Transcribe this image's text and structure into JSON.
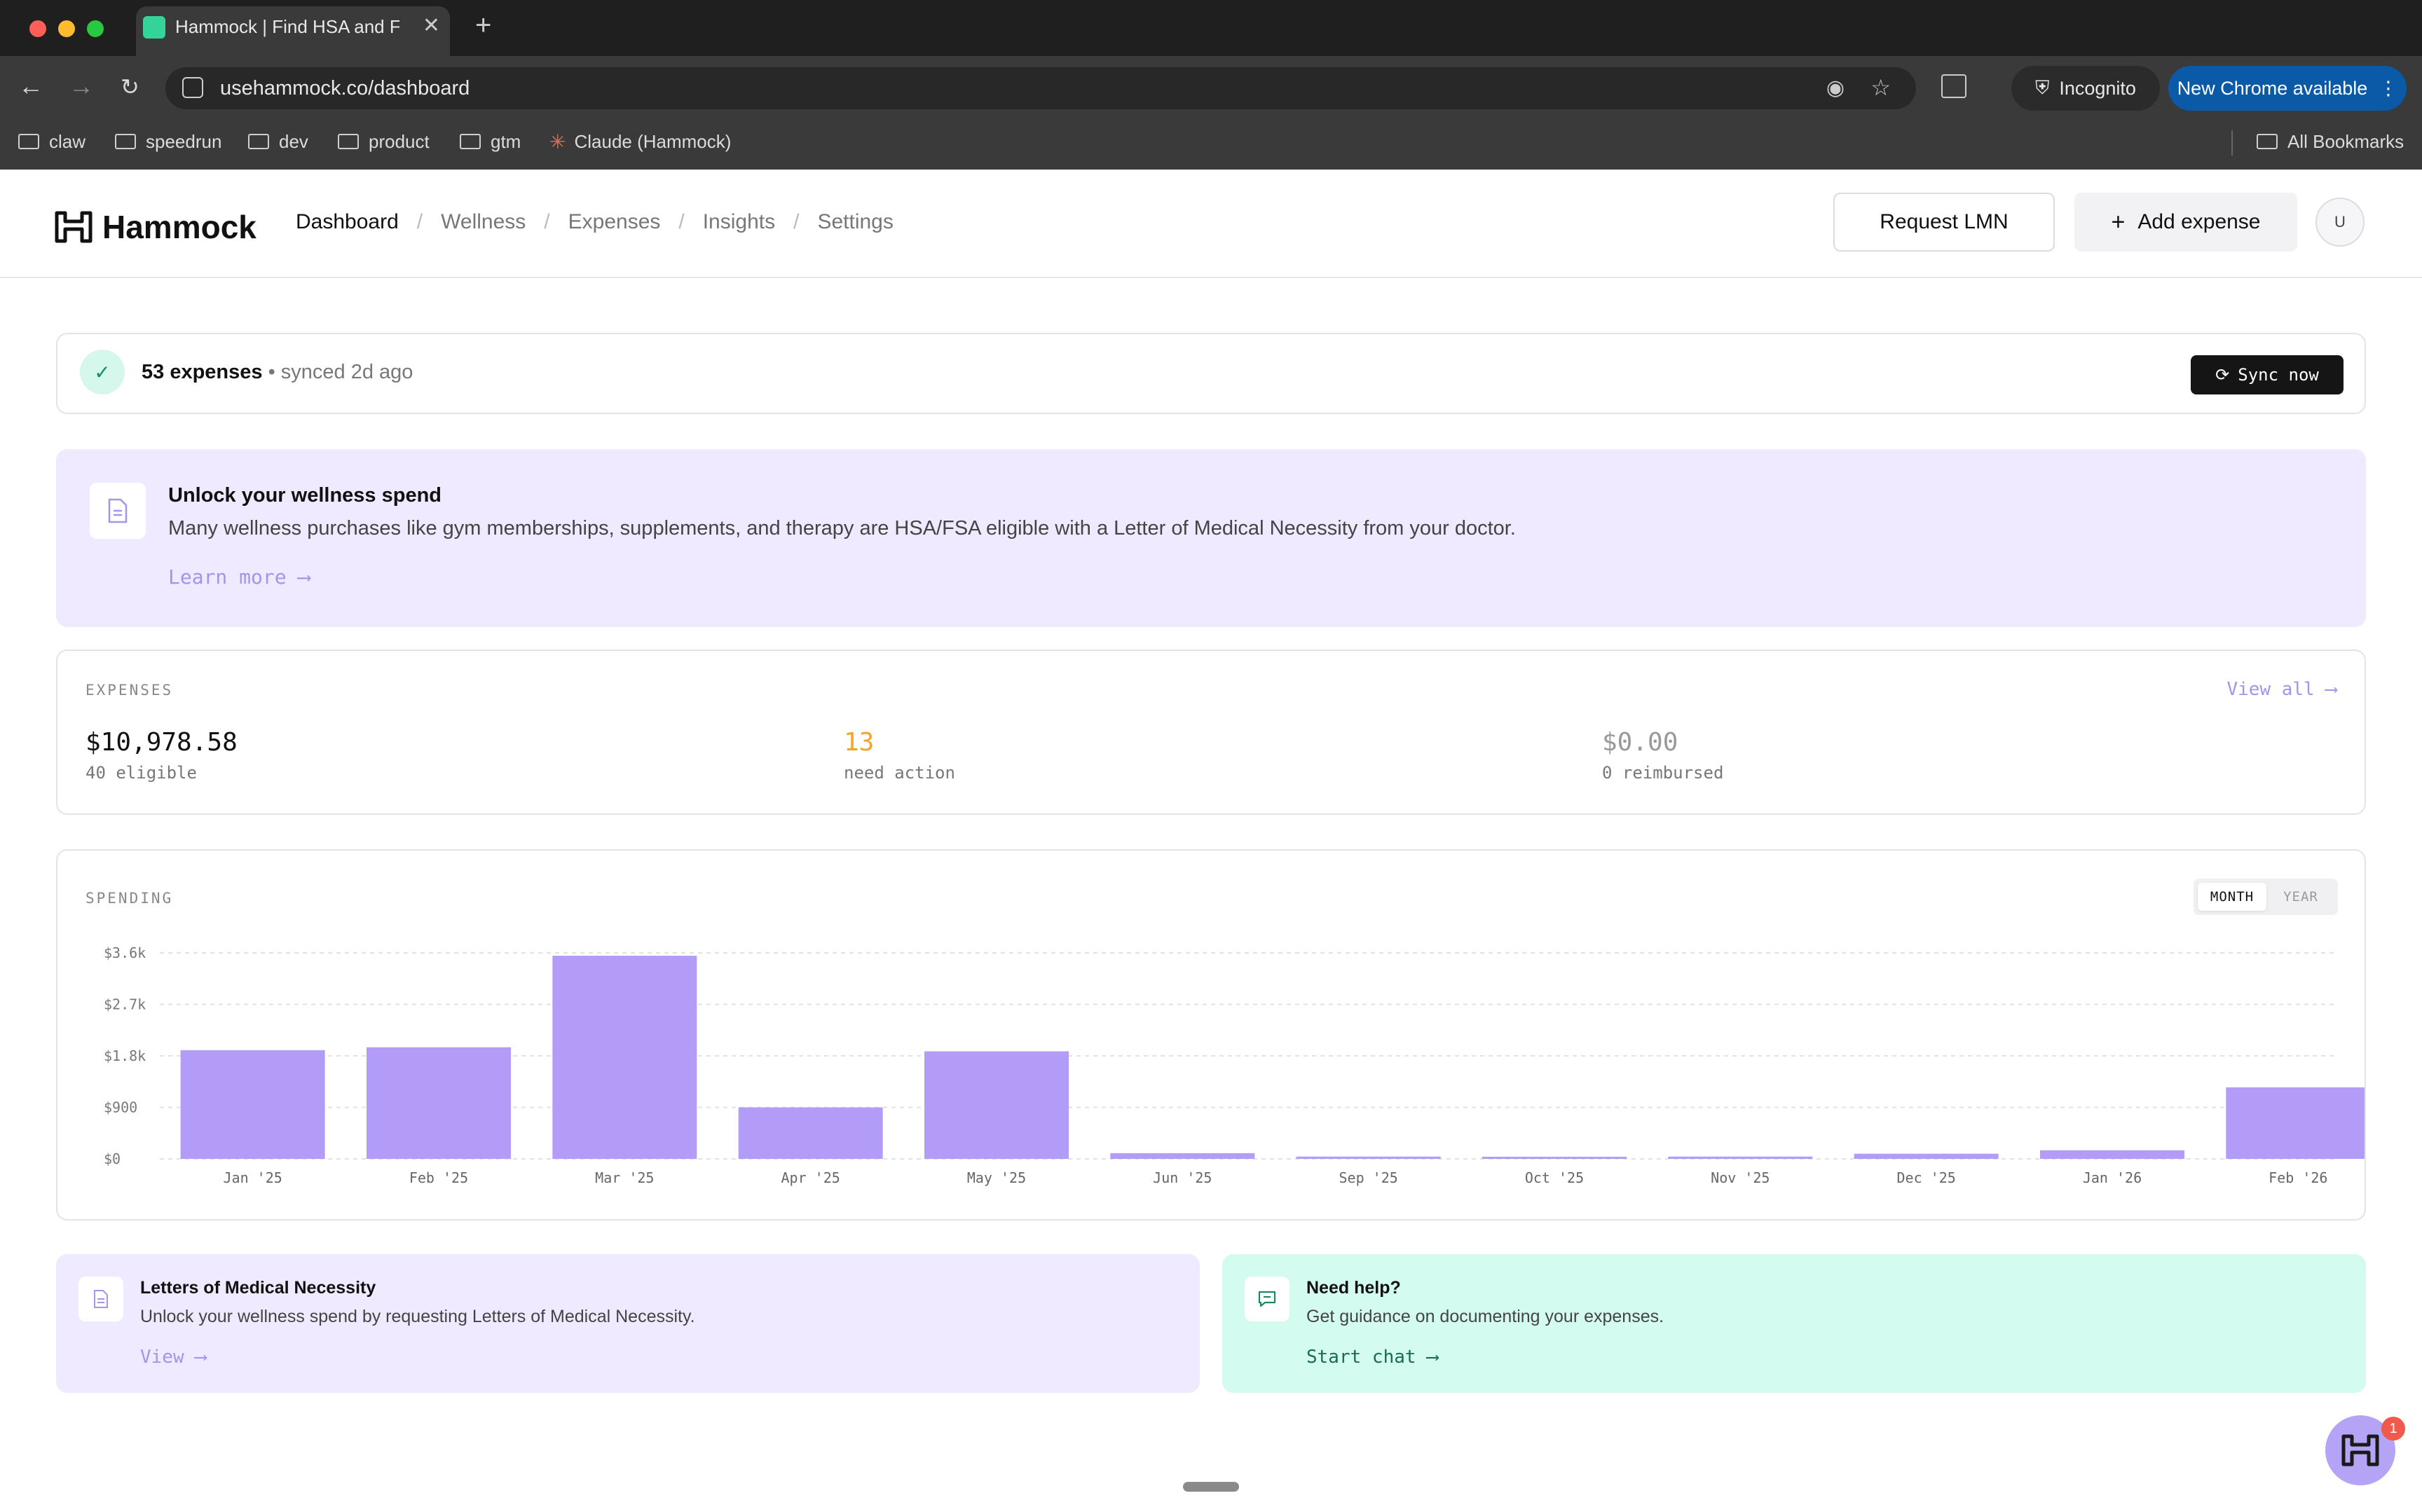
{
  "browser": {
    "tab_title": "Hammock | Find HSA and FS/",
    "new_tab": "+",
    "url": "usehammock.co/dashboard",
    "incognito_label": "Incognito",
    "update_label": "New Chrome available",
    "bookmarks": [
      "claw",
      "speedrun",
      "dev",
      "product",
      "gtm",
      "Claude (Hammock)"
    ],
    "all_bookmarks": "All Bookmarks"
  },
  "header": {
    "brand": "Hammock",
    "nav": [
      "Dashboard",
      "Wellness",
      "Expenses",
      "Insights",
      "Settings"
    ],
    "separator": "/",
    "request_lmn": "Request LMN",
    "add_expense": "Add expense",
    "add_icon": "+",
    "avatar": "U"
  },
  "sync": {
    "count": "53 expenses",
    "status": "• synced 2d ago",
    "button": "Sync now"
  },
  "banner": {
    "title": "Unlock your wellness spend",
    "desc": "Many wellness purchases like gym memberships, supplements, and therapy are HSA/FSA eligible with a Letter of Medical Necessity from your doctor.",
    "link": "Learn more ⟶"
  },
  "expenses": {
    "label": "EXPENSES",
    "view_all": "View all ⟶",
    "total": "$10,978.58",
    "eligible": "40 eligible",
    "need_action_count": "13",
    "need_action": "need action",
    "reimbursed_amount": "$0.00",
    "reimbursed": "0 reimbursed",
    "need_action_color": "#f5a524"
  },
  "spending": {
    "label": "SPENDING",
    "toggle_month": "MONTH",
    "toggle_year": "YEAR"
  },
  "chart_data": {
    "type": "bar",
    "categories": [
      "Jan '25",
      "Feb '25",
      "Mar '25",
      "Apr '25",
      "May '25",
      "Jun '25",
      "Sep '25",
      "Oct '25",
      "Nov '25",
      "Dec '25",
      "Jan '26",
      "Feb '26"
    ],
    "values": [
      1900,
      1950,
      3550,
      900,
      1880,
      100,
      40,
      20,
      40,
      90,
      150,
      1250
    ],
    "yticks": [
      "$0",
      "$900",
      "$1.8k",
      "$2.7k",
      "$3.6k"
    ],
    "ytick_values": [
      0,
      900,
      1800,
      2700,
      3600
    ],
    "ylim": [
      0,
      3600
    ],
    "bar_color": "#b39cf7",
    "grid": true
  },
  "cards": {
    "lmn_title": "Letters of Medical Necessity",
    "lmn_desc": "Unlock your wellness spend by requesting Letters of Medical Necessity.",
    "lmn_link": "View ⟶",
    "help_title": "Need help?",
    "help_desc": "Get guidance on documenting your expenses.",
    "help_link": "Start chat ⟶"
  },
  "fab_badge": "1"
}
